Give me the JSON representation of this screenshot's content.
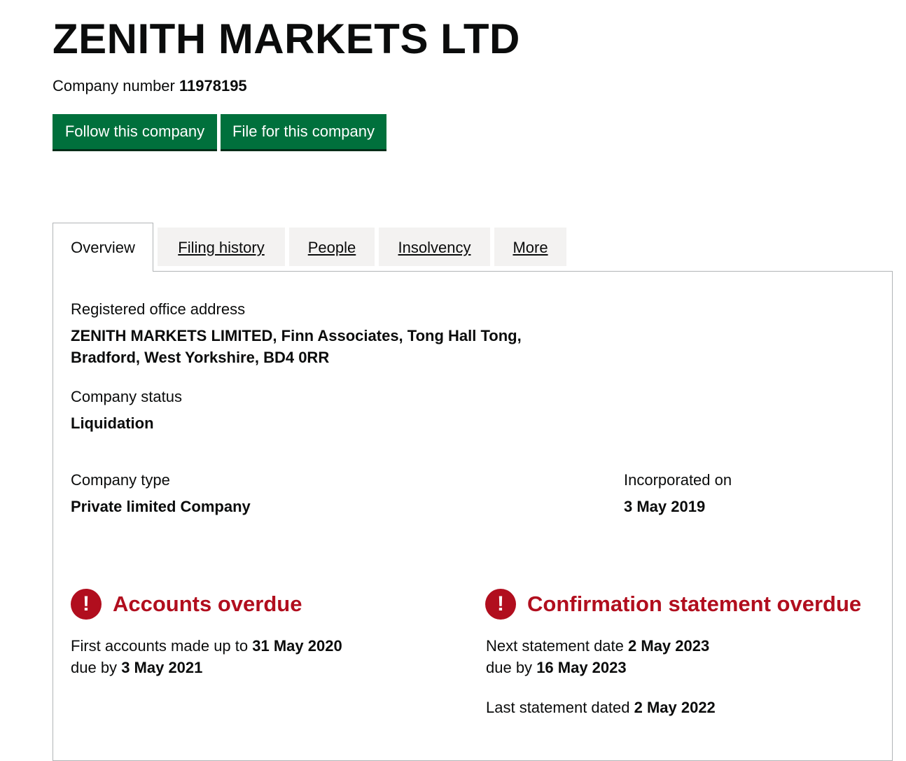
{
  "header": {
    "company_name": "ZENITH MARKETS LTD",
    "company_number_label": "Company number",
    "company_number": "11978195"
  },
  "actions": {
    "follow": "Follow this company",
    "file": "File for this company"
  },
  "tabs": [
    {
      "label": "Overview",
      "active": true
    },
    {
      "label": "Filing history"
    },
    {
      "label": "People"
    },
    {
      "label": "Insolvency"
    },
    {
      "label": "More"
    }
  ],
  "overview": {
    "registered_office_label": "Registered office address",
    "registered_office_line1": "ZENITH MARKETS LIMITED, Finn Associates, Tong Hall Tong,",
    "registered_office_line2": "Bradford, West Yorkshire, BD4 0RR",
    "status_label": "Company status",
    "status_value": "Liquidation",
    "type_label": "Company type",
    "type_value": "Private limited Company",
    "incorporated_label": "Incorporated on",
    "incorporated_value": "3 May 2019"
  },
  "accounts": {
    "title": "Accounts overdue",
    "first_prefix": "First accounts made up to",
    "first_date": "31 May 2020",
    "due_prefix": "due by",
    "due_date": "3 May 2021"
  },
  "confirmation": {
    "title": "Confirmation statement overdue",
    "next_prefix": "Next statement date",
    "next_date": "2 May 2023",
    "due_prefix": "due by",
    "due_date": "16 May 2023",
    "last_prefix": "Last statement dated",
    "last_date": "2 May 2022"
  },
  "icons": {
    "warning": "exclamation-circle-icon",
    "warning_glyph": "!"
  },
  "colors": {
    "primary_button": "#00703c",
    "warning": "#b10e1e",
    "tab_background": "#f3f2f1"
  }
}
